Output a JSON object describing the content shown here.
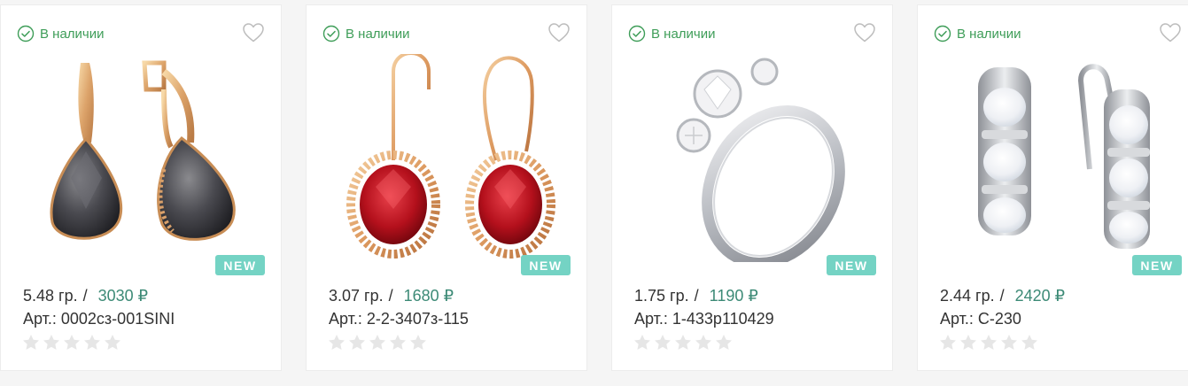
{
  "products": [
    {
      "stock": "В наличии",
      "badge": "NEW",
      "weight": "5.48 гр.",
      "separator": "/",
      "price": "3030 ₽",
      "article_label": "Арт.:",
      "article": "0002сз-001SINI",
      "rating": 0,
      "rating_max": 5,
      "image": "black-pear-stone-gold-earrings"
    },
    {
      "stock": "В наличии",
      "badge": "NEW",
      "weight": "3.07 гр.",
      "separator": "/",
      "price": "1680 ₽",
      "article_label": "Арт.:",
      "article": "2-2-3407з-115",
      "rating": 0,
      "rating_max": 5,
      "image": "red-oval-stone-gold-hook-earrings"
    },
    {
      "stock": "В наличии",
      "badge": "NEW",
      "weight": "1.75 гр.",
      "separator": "/",
      "price": "1190 ₽",
      "article_label": "Арт.:",
      "article": "1-433р110429",
      "rating": 0,
      "rating_max": 5,
      "image": "silver-three-stone-ring"
    },
    {
      "stock": "В наличии",
      "badge": "NEW",
      "weight": "2.44 гр.",
      "separator": "/",
      "price": "2420 ₽",
      "article_label": "Арт.:",
      "article": "С-230",
      "rating": 0,
      "rating_max": 5,
      "image": "silver-moonstone-earrings"
    }
  ],
  "colors": {
    "in_stock": "#3e9d58",
    "price": "#3c8a76",
    "badge": "#74d3c4",
    "star_empty": "#e6e6e6"
  },
  "icons": {
    "stock": "check-circle-icon",
    "favorite": "heart-outline-icon",
    "rating": "star-icon"
  }
}
